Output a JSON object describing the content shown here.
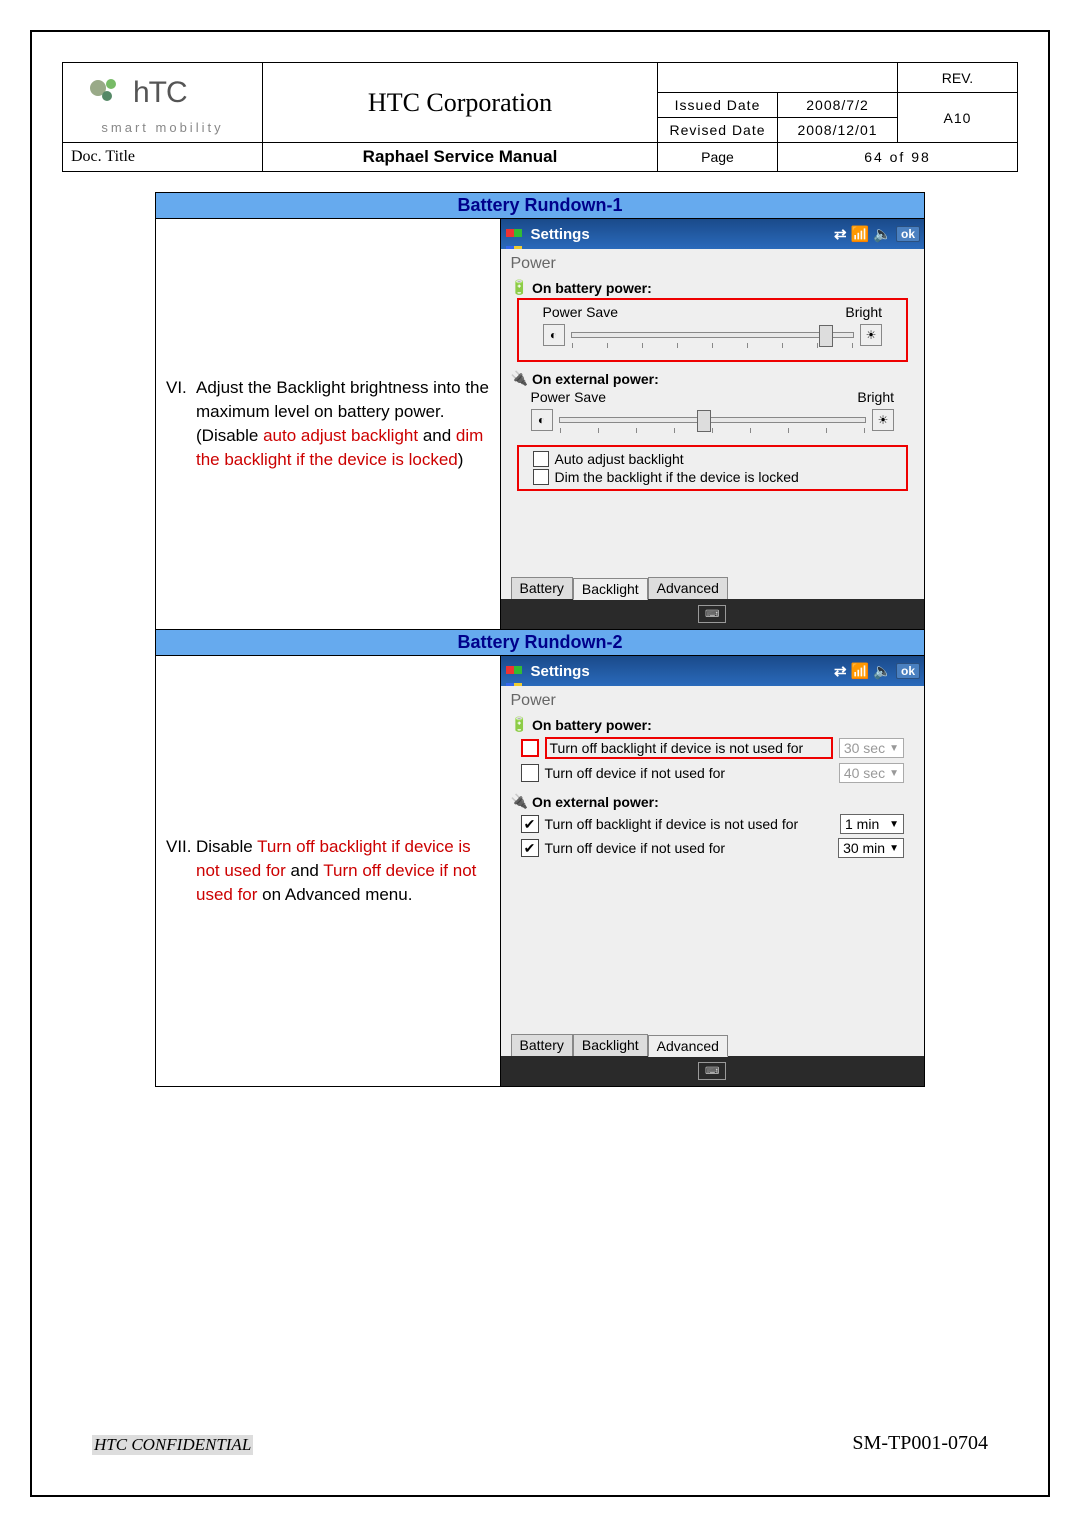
{
  "header": {
    "logo_sub": "smart mobility",
    "corp": "HTC Corporation",
    "rev_label": "REV.",
    "rev_value": "A10",
    "issued_label": "Issued Date",
    "issued_value": "2008/7/2",
    "revised_label": "Revised Date",
    "revised_value": "2008/12/01",
    "doc_title_label": "Doc. Title",
    "doc_title_value": "Raphael Service Manual",
    "page_label": "Page",
    "page_value": "64 of 98"
  },
  "sections": {
    "r1": {
      "title": "Battery Rundown-1",
      "marker": "VI.",
      "text_black1": "Adjust the Backlight brightness into the maximum level on battery power. (Disable ",
      "text_red1": "auto adjust backlight",
      "text_black2": " and ",
      "text_red2": "dim the backlight if the device is locked",
      "text_black3": ")"
    },
    "r2": {
      "title": "Battery Rundown-2",
      "marker": "VII.",
      "text_black1": "Disable ",
      "text_red1": "Turn off backlight if device is not used for",
      "text_black2": " and ",
      "text_red2": "Turn off device if not used for",
      "text_black3": " on Advanced menu."
    }
  },
  "wm": {
    "settings": "Settings",
    "ok": "ok",
    "power_title": "Power",
    "on_battery": "On battery power:",
    "on_external": "On external power:",
    "power_save": "Power Save",
    "bright": "Bright",
    "auto_adjust": "Auto adjust backlight",
    "dim_if_locked": "Dim the backlight if the device is locked",
    "tab_battery": "Battery",
    "tab_backlight": "Backlight",
    "tab_advanced": "Advanced",
    "turnoff_backlight": "Turn off backlight if device is not used for",
    "turnoff_device": "Turn off device if not used for",
    "dd_30sec": "30 sec",
    "dd_40sec": "40 sec",
    "dd_1min": "1 min",
    "dd_30min": "30 min"
  },
  "footer": {
    "confidential": "HTC CONFIDENTIAL",
    "docnum": "SM-TP001-0704"
  }
}
